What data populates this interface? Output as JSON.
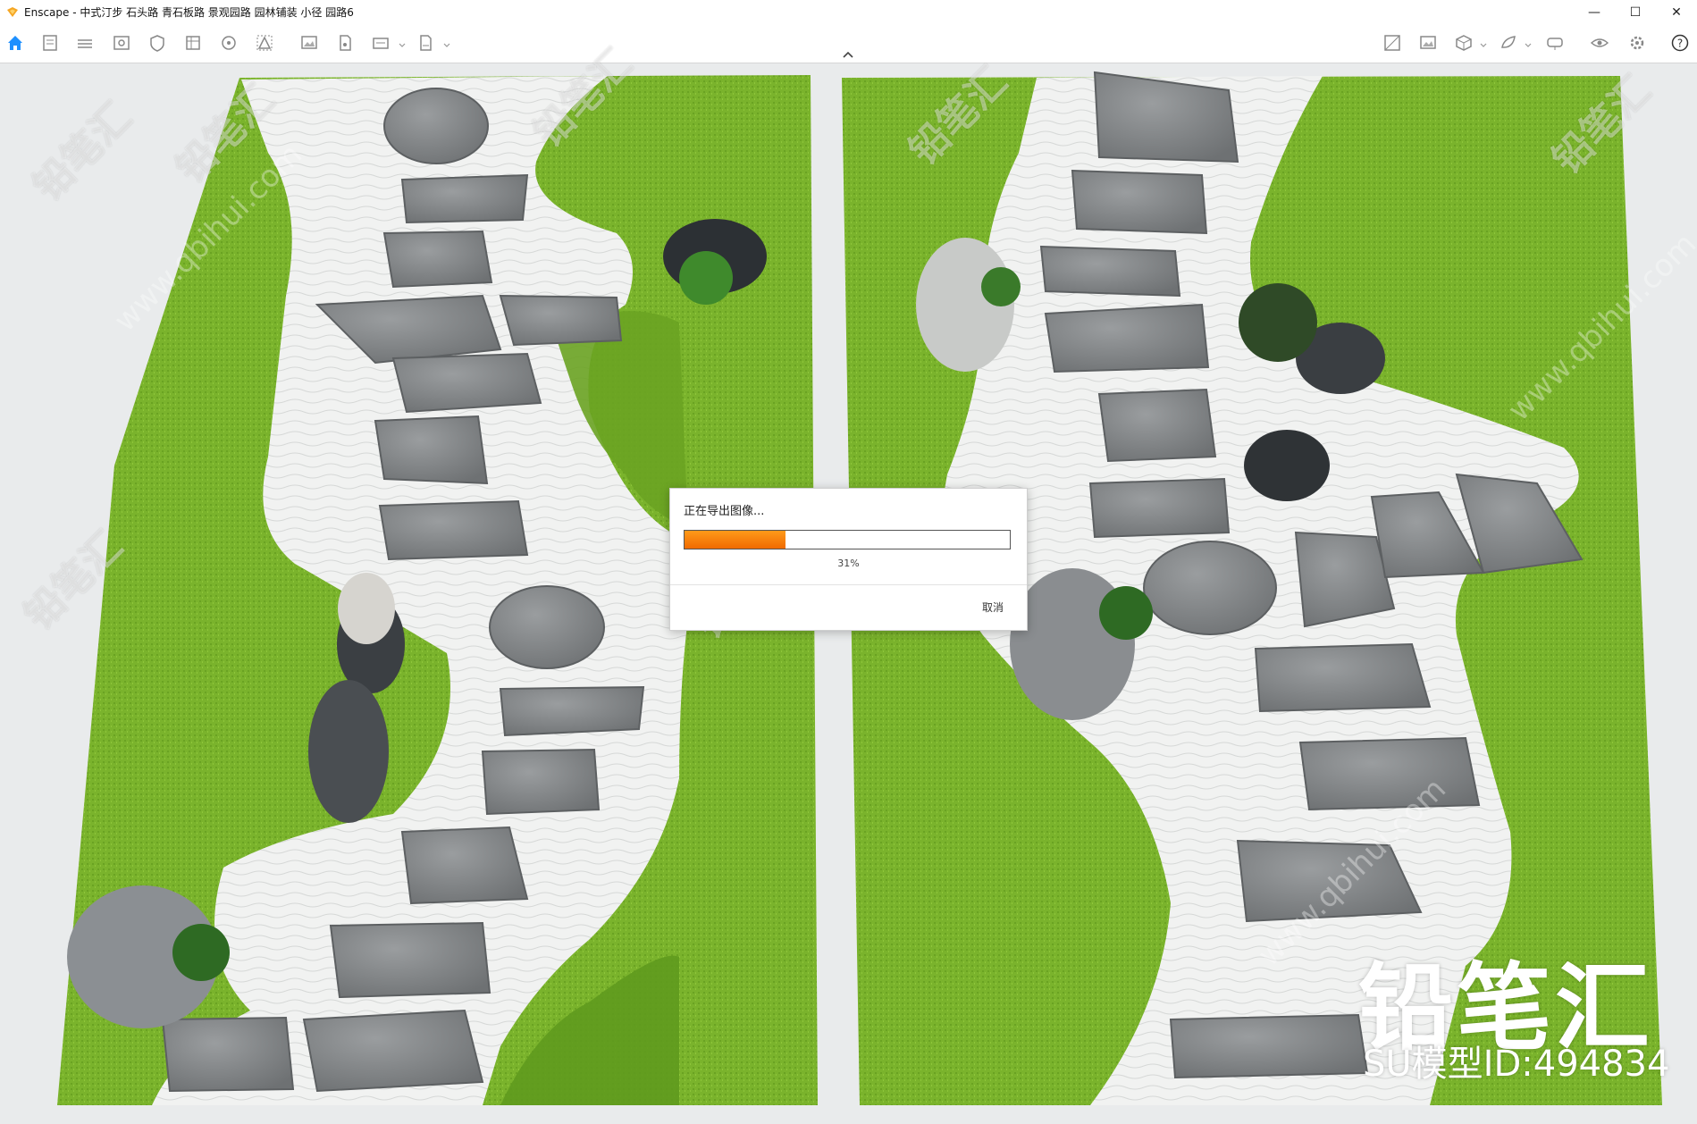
{
  "window": {
    "title": "Enscape - 中式汀步 石头路 青石板路 景观园路 园林铺装 小径 园路6",
    "minimize_label": "—",
    "maximize_label": "☐",
    "close_label": "✕"
  },
  "toolbar": {
    "left_icons": [
      "home-icon",
      "project-manager-icon",
      "bim-icon",
      "view-management-icon",
      "visual-settings-icon",
      "site-context-icon",
      "atmosphere-icon",
      "asset-library-icon",
      "material-editor-icon",
      "screenshot-icon",
      "export-icon",
      "batch-render-icon",
      "collaboration-icon"
    ],
    "right_icons": [
      "capture-image-icon",
      "image-export-icon",
      "model-export-icon",
      "feedback-icon",
      "vr-headset-icon",
      "visibility-icon",
      "settings-icon",
      "help-icon"
    ]
  },
  "export_dialog": {
    "title": "正在导出图像...",
    "progress": 0.31,
    "progress_text": "31%",
    "cancel_label": "取消"
  },
  "watermark": {
    "brand": "铅笔汇",
    "model_id": "SU模型ID:494834",
    "url": "www.qbihui.com"
  },
  "colors": {
    "accent": "#f5a623",
    "progress": "#f07a00",
    "grass": "#7cb22e",
    "gravel": "#f1f2f1",
    "stone": "#8a8d8f"
  }
}
